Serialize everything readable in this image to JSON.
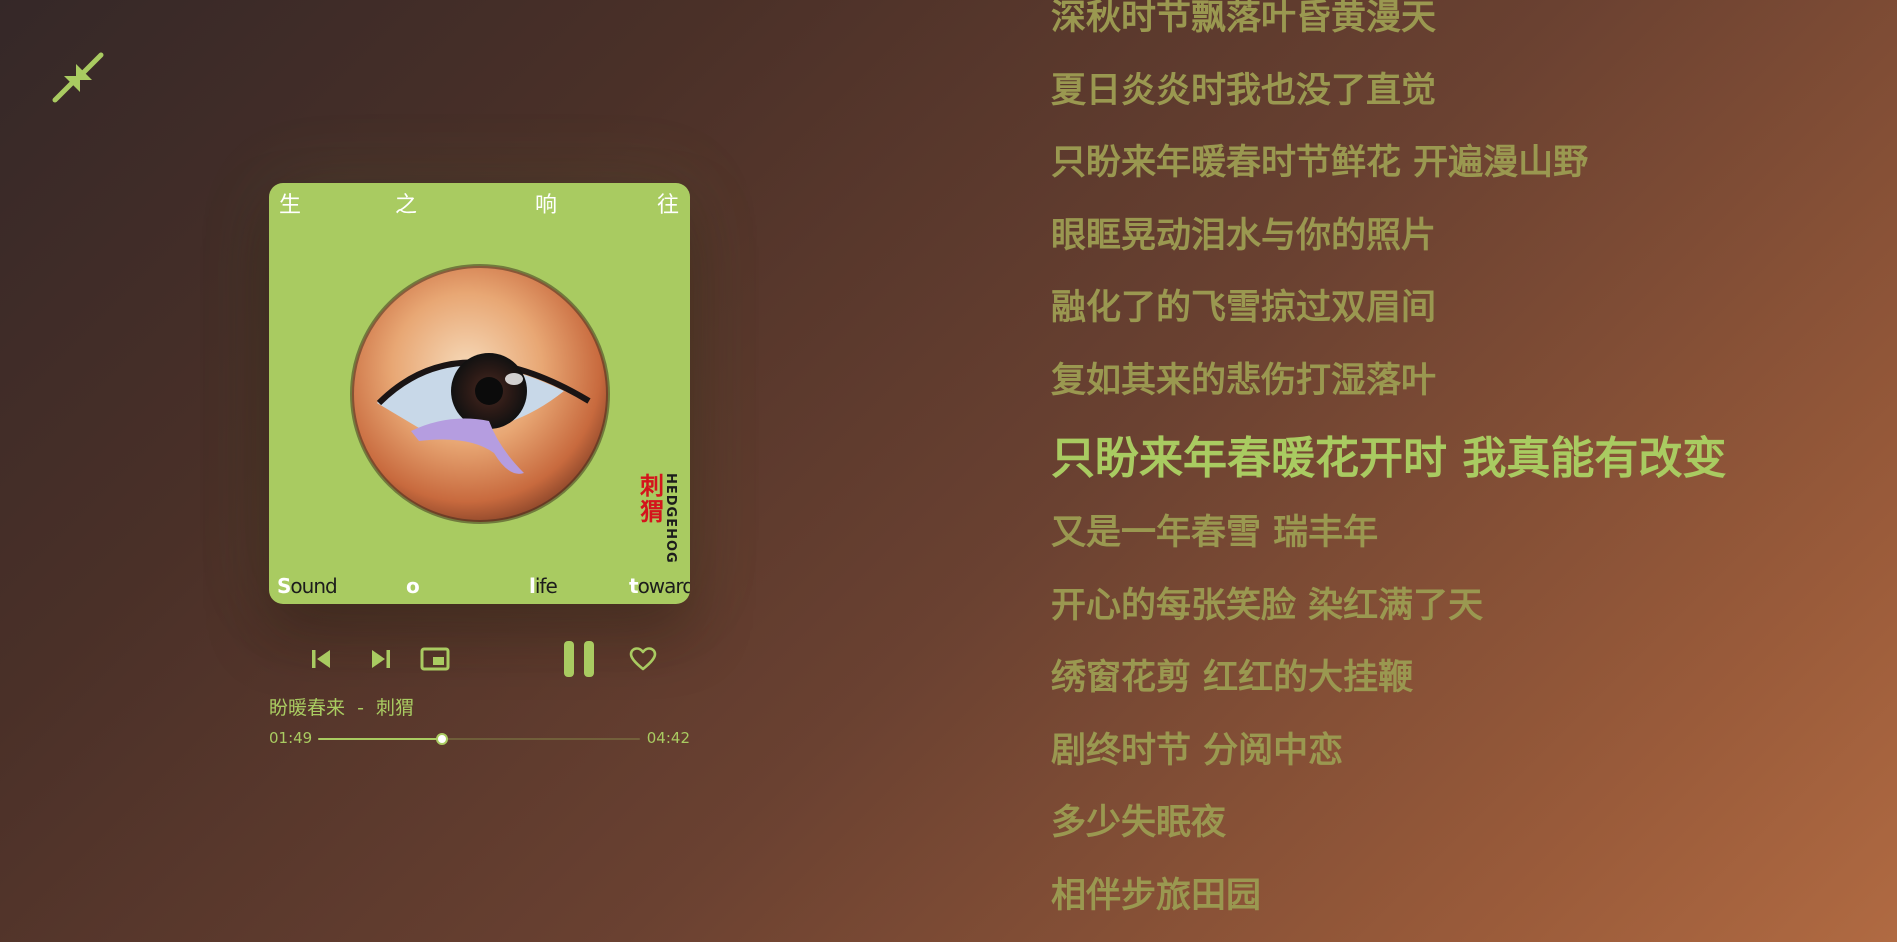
{
  "player": {
    "collapse_icon": "collapse-arrows-icon",
    "song_title": "盼暖春来",
    "separator": "-",
    "artist": "刺猬",
    "current_time": "01:49",
    "total_time": "04:42",
    "progress_fraction": 0.386,
    "controls": {
      "prev_icon": "skip-previous-icon",
      "next_icon": "skip-next-icon",
      "pip_icon": "picture-in-picture-icon",
      "pause_icon": "pause-icon",
      "like_icon": "heart-icon"
    },
    "accent_color": "#a9cb61"
  },
  "cover": {
    "top_text": [
      "生",
      "之",
      "响",
      "往"
    ],
    "bottom_text": [
      {
        "first": "S",
        "rest": "ound"
      },
      {
        "first": "o",
        "rest": ""
      },
      {
        "first": "l",
        "rest": "ife"
      },
      {
        "first": "t",
        "rest": "owards"
      }
    ],
    "band_cn": "刺猬",
    "band_en": "HEDGEHOG",
    "background_color": "#a9cb61"
  },
  "lyrics": {
    "lines": [
      "深秋时节飘落叶昏黄漫天",
      "夏日炎炎时我也没了直觉",
      "只盼来年暖春时节鲜花 开遍漫山野",
      "眼眶晃动泪水与你的照片",
      "融化了的飞雪掠过双眉间",
      "复如其来的悲伤打湿落叶",
      "只盼来年春暖花开时 我真能有改变",
      "又是一年春雪 瑞丰年",
      "开心的每张笑脸 染红满了天",
      "绣窗花剪 红红的大挂鞭",
      "剧终时节 分阅中恋",
      "多少失眠夜",
      "相伴步旅田园"
    ],
    "active_index": 6,
    "inactive_color": "#9a9850"
  }
}
